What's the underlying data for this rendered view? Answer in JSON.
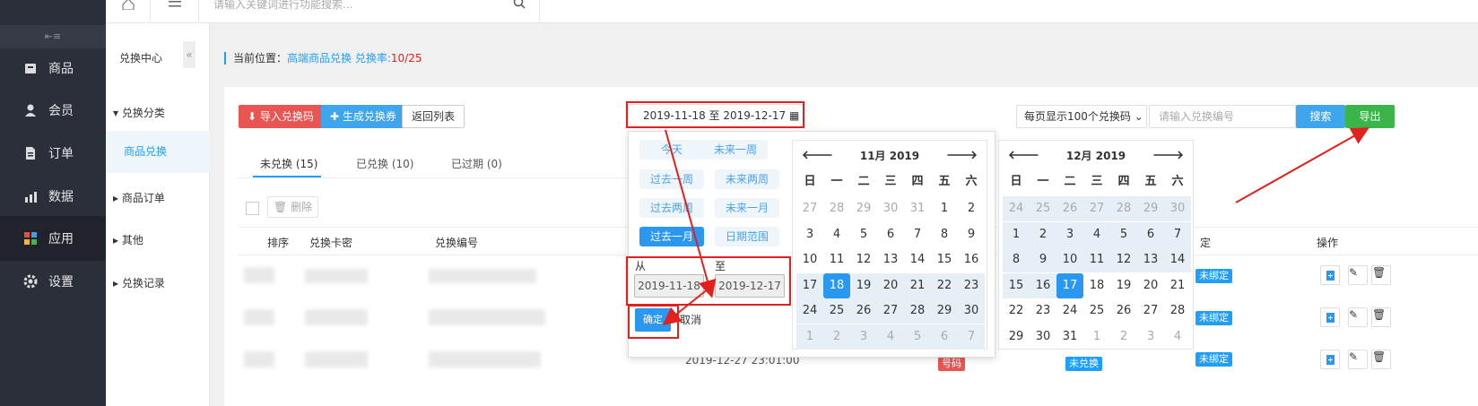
{
  "leftnav": {
    "collapse_icon": "collapse-icon",
    "items": [
      {
        "label": "商品",
        "icon": "shop-icon"
      },
      {
        "label": "会员",
        "icon": "user-icon"
      },
      {
        "label": "订单",
        "icon": "doc-icon"
      },
      {
        "label": "数据",
        "icon": "chart-icon"
      },
      {
        "label": "应用",
        "icon": "apps-icon"
      },
      {
        "label": "设置",
        "icon": "gear-icon"
      }
    ]
  },
  "topbar": {
    "search_placeholder": "请输入关键词进行功能搜索..."
  },
  "subnav": {
    "title": "兑换中心",
    "groups": [
      {
        "label": "兑换分类",
        "items": [
          "商品兑换"
        ]
      },
      {
        "label": "商品订单"
      },
      {
        "label": "其他"
      },
      {
        "label": "兑换记录"
      }
    ]
  },
  "crumb": {
    "prefix": "当前位置：",
    "link": "高端商品兑换",
    "rate_label": "兑换率:",
    "rate": "10/25"
  },
  "toolbar": {
    "import": "导入兑换码",
    "generate": "生成兑换券",
    "back": "返回列表",
    "date_range": "2019-11-18 至 2019-12-17",
    "page_size": "每页显示100个兑换码",
    "search_placeholder": "请输入兑换编号",
    "search": "搜索",
    "export": "导出"
  },
  "tabs": [
    "未兑换 (15)",
    "已兑换 (10)",
    "已过期 (0)"
  ],
  "list": {
    "delete": "删除",
    "headers": [
      "排序",
      "兑换卡密",
      "兑换编号",
      "定",
      "操作"
    ],
    "row3_date": "2019-12-27 23:01:00",
    "badges": [
      "未绑定",
      "未绑定",
      "未绑定"
    ],
    "row3_tags": [
      "号码",
      "未兑换"
    ]
  },
  "picker": {
    "ranges": [
      "今天",
      "未来一周",
      "过去一周",
      "未来两周",
      "过去两周",
      "未来一月",
      "过去一月",
      "日期范围"
    ],
    "from_label": "从",
    "to_label": "至",
    "from": "2019-11-18",
    "to": "2019-12-17",
    "ok": "确定",
    "cancel": "取消",
    "weekdays": [
      "日",
      "一",
      "二",
      "三",
      "四",
      "五",
      "六"
    ],
    "nov": {
      "title": "11月 2019",
      "days": [
        "27",
        "28",
        "29",
        "30",
        "31",
        "1",
        "2",
        "3",
        "4",
        "5",
        "6",
        "7",
        "8",
        "9",
        "10",
        "11",
        "12",
        "13",
        "14",
        "15",
        "16",
        "17",
        "18",
        "19",
        "20",
        "21",
        "22",
        "23",
        "24",
        "25",
        "26",
        "27",
        "28",
        "29",
        "30",
        "1",
        "2",
        "3",
        "4",
        "5",
        "6",
        "7"
      ]
    },
    "dec": {
      "title": "12月 2019",
      "days": [
        "24",
        "25",
        "26",
        "27",
        "28",
        "29",
        "30",
        "1",
        "2",
        "3",
        "4",
        "5",
        "6",
        "7",
        "8",
        "9",
        "10",
        "11",
        "12",
        "13",
        "14",
        "15",
        "16",
        "17",
        "18",
        "19",
        "20",
        "21",
        "22",
        "23",
        "24",
        "25",
        "26",
        "27",
        "28",
        "29",
        "30",
        "31",
        "1",
        "2",
        "3",
        "4"
      ]
    }
  },
  "colors": {
    "primary": "#1e9fff",
    "danger": "#e2211c",
    "export": "#3bb54a"
  }
}
